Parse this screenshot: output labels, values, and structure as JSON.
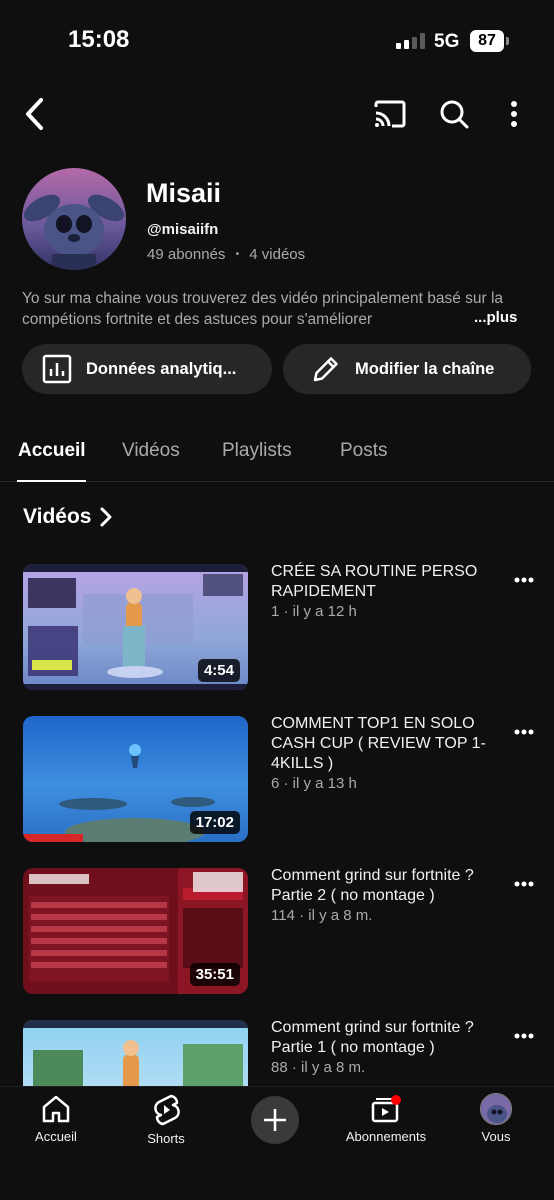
{
  "status_bar": {
    "time": "15:08",
    "network": "5G",
    "battery": "87"
  },
  "channel": {
    "name": "Misaii",
    "handle": "@misaiifn",
    "subscribers": "49 abonnés",
    "separator": "•",
    "videos_count": "4 vidéos",
    "description": "Yo sur ma chaine vous trouverez des vidéo principalement basé sur la compétions fortnite et des astuces pour s'améliorer",
    "more_label": "...plus",
    "analytics_button": "Données analytiq...",
    "edit_button": "Modifier la chaîne"
  },
  "tabs": [
    {
      "label": "Accueil",
      "active": true
    },
    {
      "label": "Vidéos",
      "active": false
    },
    {
      "label": "Playlists",
      "active": false
    },
    {
      "label": "Posts",
      "active": false
    }
  ],
  "section": {
    "title": "Vidéos"
  },
  "videos": [
    {
      "title": "CRÉE SA ROUTINE PERSO RAPIDEMENT",
      "meta": "1 · il y a 12 h",
      "duration": "4:54"
    },
    {
      "title": "COMMENT TOP1 EN SOLO CASH CUP ( REVIEW TOP 1-4KILLS )",
      "meta": "6 · il y a 13 h",
      "duration": "17:02"
    },
    {
      "title": "Comment grind sur fortnite ? Partie 2 ( no montage )",
      "meta": "114 · il y a 8 m.",
      "duration": "35:51"
    },
    {
      "title": "Comment grind sur fortnite ? Partie 1 ( no montage )",
      "meta": "88 · il y a 8 m.",
      "duration": ""
    }
  ],
  "bottom_nav": {
    "home": "Accueil",
    "shorts": "Shorts",
    "subscriptions": "Abonnements",
    "you": "Vous"
  },
  "colors": {
    "background": "#0f0f0f",
    "chip": "#272727",
    "accent_red": "#ff0000",
    "secondary_text": "#aaaaaa"
  },
  "icons": [
    "back-arrow-icon",
    "cast-icon",
    "search-icon",
    "more-vert-icon",
    "analytics-icon",
    "pencil-icon",
    "chevron-right-icon",
    "home-icon",
    "shorts-icon",
    "plus-icon",
    "subscriptions-icon"
  ]
}
